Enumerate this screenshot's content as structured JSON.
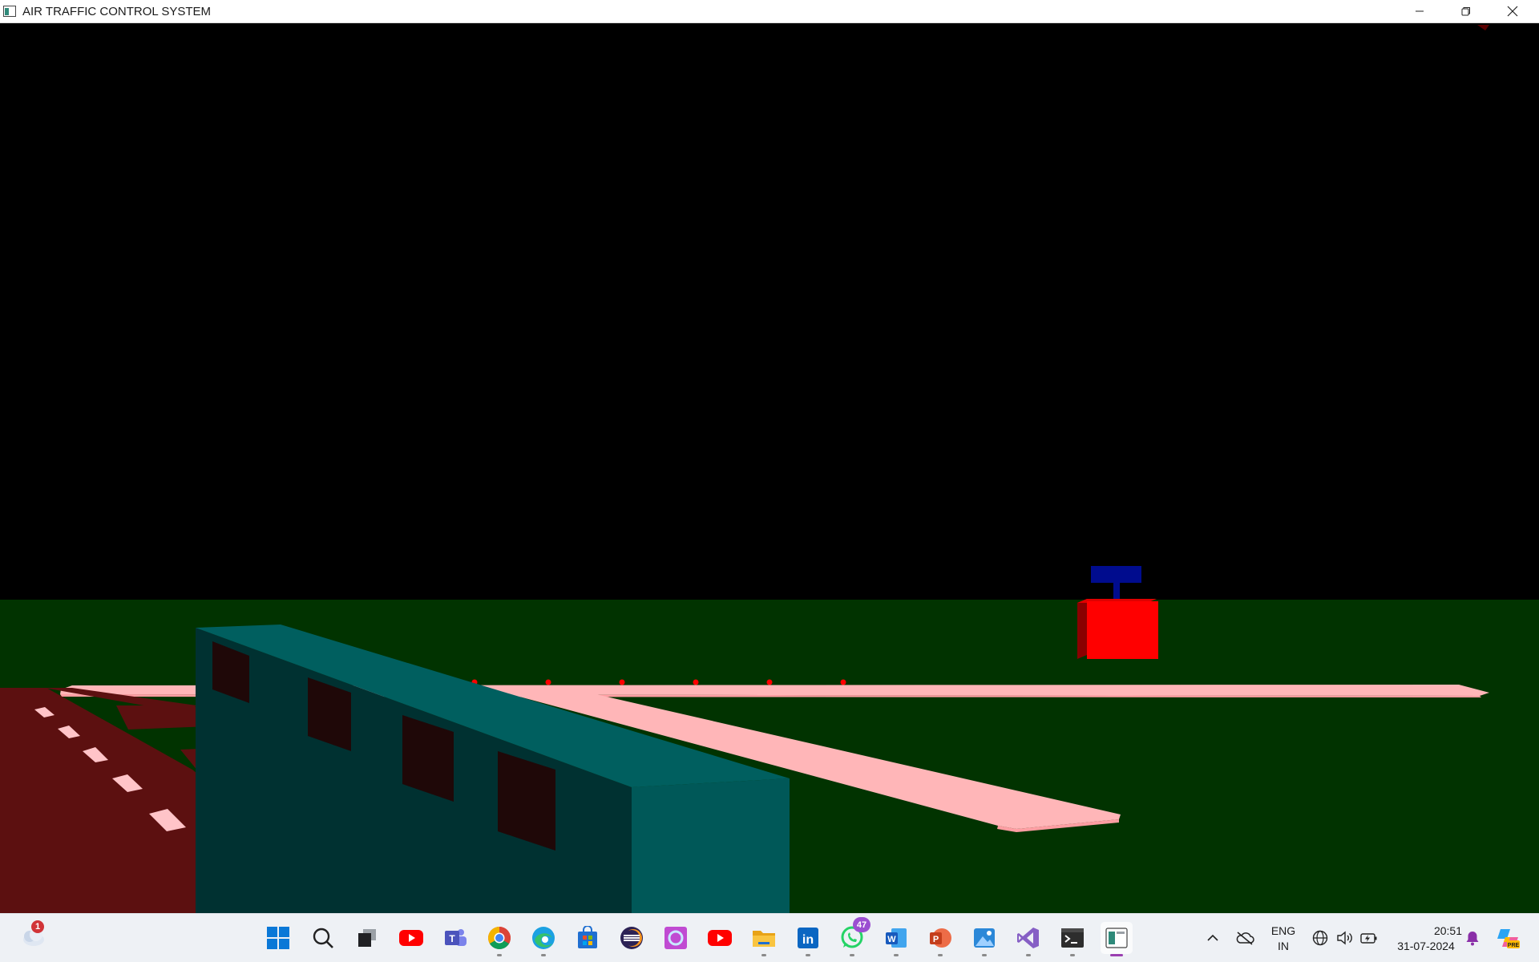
{
  "window": {
    "title": "AIR TRAFFIC CONTROL SYSTEM"
  },
  "window_controls": {
    "minimize": "minimize",
    "restore": "restore",
    "close": "close"
  },
  "scene": {
    "description_colors": {
      "sky": "#000000",
      "grass": "#013300",
      "runway": "#ffb6b8",
      "taxiway": "#5c1010",
      "terminal": "#005f5f",
      "control_tower_base": "#ff0000",
      "control_tower_top": "#000c8e",
      "runway_lights": "#ff0000"
    }
  },
  "taskbar": {
    "weather_badge": "1",
    "apps": [
      {
        "name": "start-button",
        "icon": "windows-logo-icon"
      },
      {
        "name": "search-button",
        "icon": "search-icon"
      },
      {
        "name": "task-view-button",
        "icon": "task-view-icon"
      },
      {
        "name": "youtube-app",
        "icon": "youtube-icon"
      },
      {
        "name": "teams-app",
        "icon": "teams-icon"
      },
      {
        "name": "chrome-app",
        "icon": "chrome-icon"
      },
      {
        "name": "edge-app",
        "icon": "edge-icon"
      },
      {
        "name": "store-app",
        "icon": "store-icon"
      },
      {
        "name": "eclipse-app",
        "icon": "eclipse-icon"
      },
      {
        "name": "copilot-ring-app",
        "icon": "ring-icon"
      },
      {
        "name": "youtube-app-2",
        "icon": "youtube-icon"
      },
      {
        "name": "file-explorer-app",
        "icon": "folder-icon"
      },
      {
        "name": "linkedin-app",
        "icon": "linkedin-icon"
      },
      {
        "name": "whatsapp-app",
        "icon": "whatsapp-icon"
      },
      {
        "name": "word-app",
        "icon": "word-icon"
      },
      {
        "name": "powerpoint-app",
        "icon": "powerpoint-icon"
      },
      {
        "name": "photos-app",
        "icon": "photos-icon"
      },
      {
        "name": "visual-studio-app",
        "icon": "visual-studio-icon"
      },
      {
        "name": "terminal-app",
        "icon": "terminal-icon"
      },
      {
        "name": "opengl-app",
        "icon": "opengl-window-icon"
      }
    ],
    "whatsapp_badge": "47",
    "tray": {
      "language_line1": "ENG",
      "language_line2": "IN",
      "time": "20:51",
      "date": "31-07-2024"
    }
  }
}
